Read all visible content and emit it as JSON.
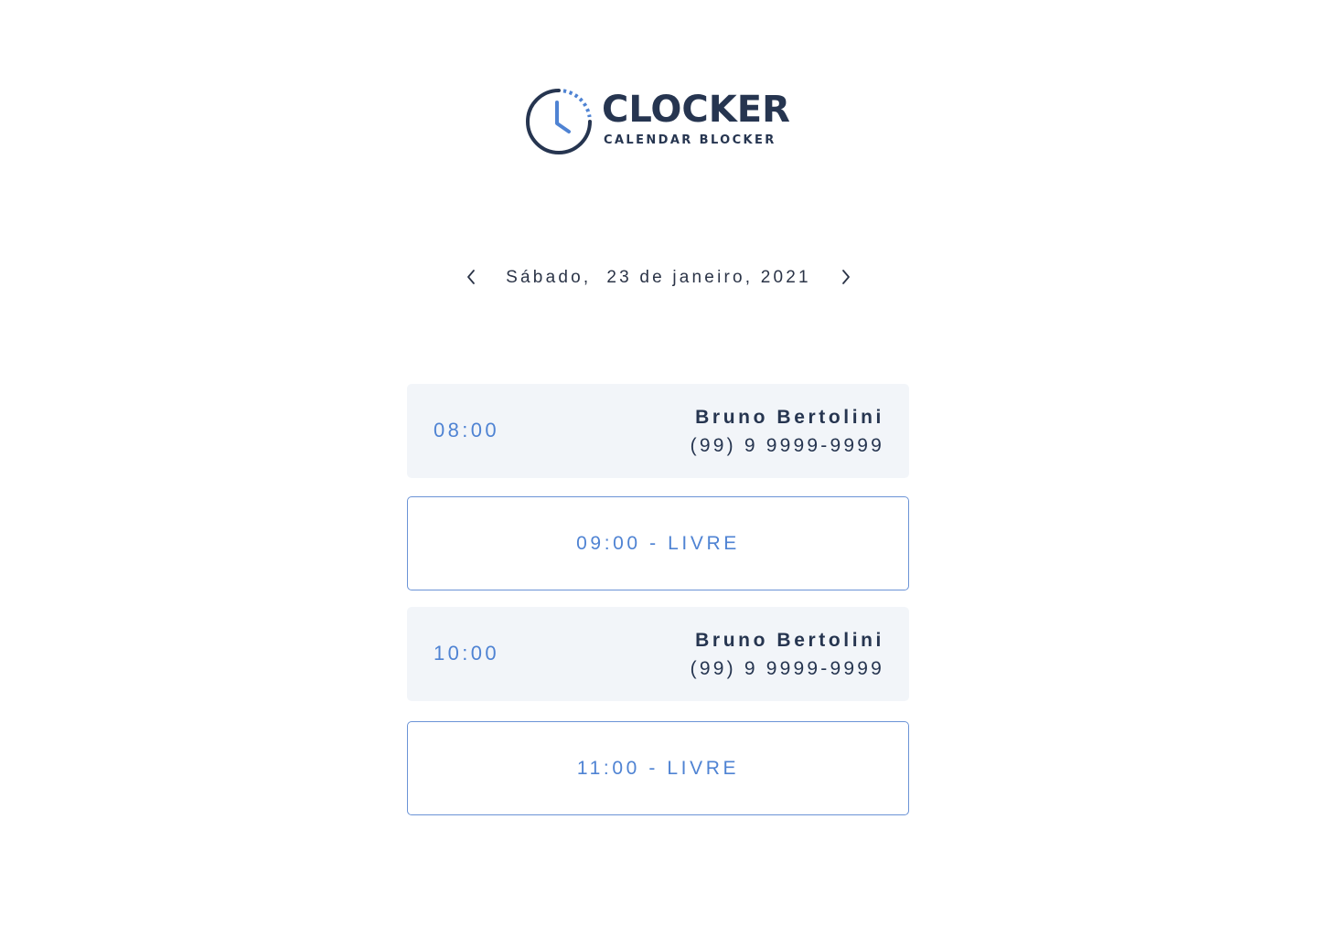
{
  "brand": {
    "name": "CLOCKER",
    "tagline": "CALENDAR BLOCKER",
    "icon": "clock-icon",
    "primary_color": "#263550",
    "accent_color": "#4f83d3"
  },
  "date_nav": {
    "prev_icon": "chevron-left-icon",
    "next_icon": "chevron-right-icon",
    "label": "Sábado,  23 de janeiro, 2021"
  },
  "slots": [
    {
      "status": "booked",
      "time": "08:00",
      "name": "Bruno Bertolini",
      "phone": "(99) 9 9999-9999"
    },
    {
      "status": "free",
      "label": "09:00 - LIVRE"
    },
    {
      "status": "booked",
      "time": "10:00",
      "name": "Bruno Bertolini",
      "phone": "(99) 9 9999-9999"
    },
    {
      "status": "free",
      "label": "11:00 - LIVRE"
    }
  ]
}
